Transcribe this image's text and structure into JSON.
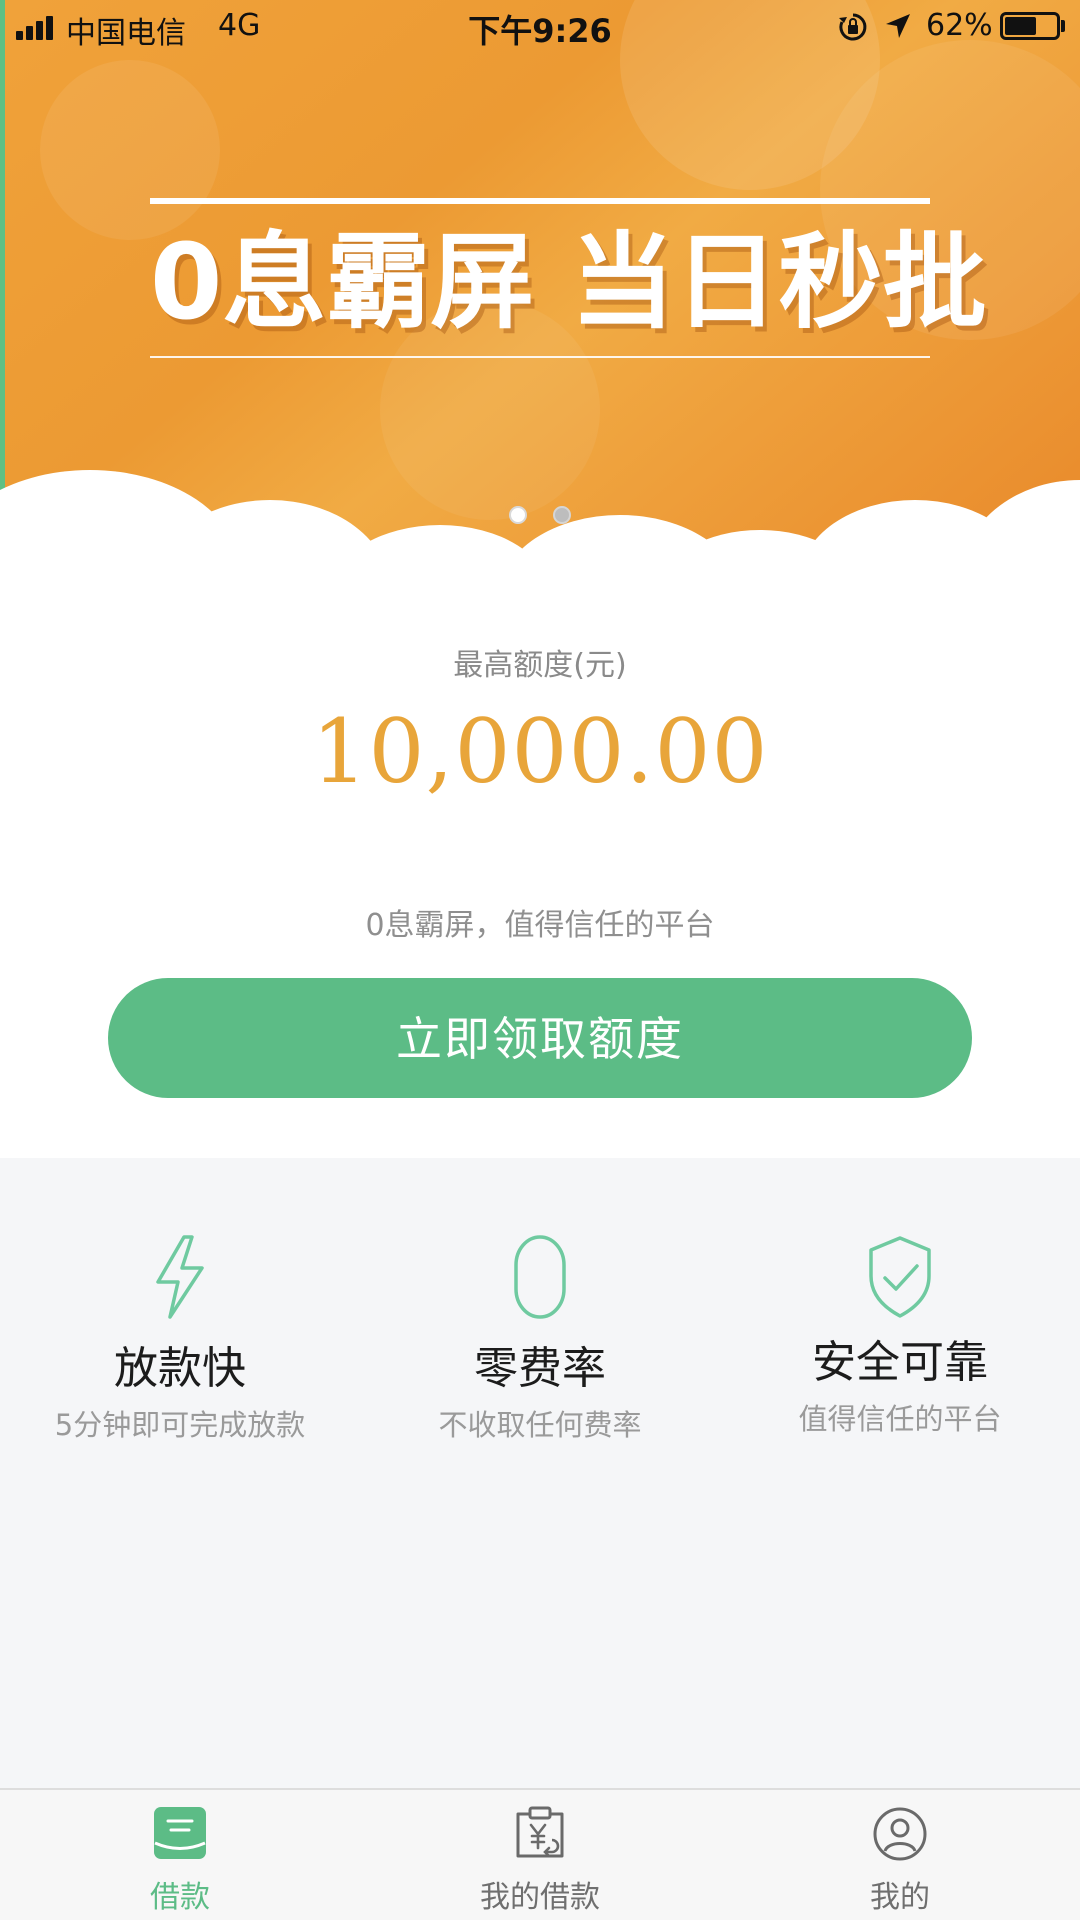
{
  "status_bar": {
    "carrier": "中国电信",
    "network": "4G",
    "time": "下午9:26",
    "battery_percent": "62%",
    "battery_level": 0.62
  },
  "banner": {
    "title": "0息霸屏 当日秒批",
    "slides": 2,
    "active_slide": 0
  },
  "credit": {
    "label": "最高额度(元)",
    "amount": "10,000.00",
    "slogan": "0息霸屏，值得信任的平台",
    "cta_label": "立即领取额度"
  },
  "features": [
    {
      "icon": "lightning-icon",
      "title": "放款快",
      "desc": "5分钟即可完成放款"
    },
    {
      "icon": "zero-icon",
      "title": "零费率",
      "desc": "不收取任何费率"
    },
    {
      "icon": "shield-check-icon",
      "title": "安全可靠",
      "desc": "值得信任的平台"
    }
  ],
  "tabs": [
    {
      "icon": "loan-icon",
      "label": "借款",
      "active": true
    },
    {
      "icon": "my-loans-icon",
      "label": "我的借款",
      "active": false
    },
    {
      "icon": "profile-icon",
      "label": "我的",
      "active": false
    }
  ],
  "colors": {
    "accent": "#5cbc86",
    "amount": "#e8a53a",
    "banner_orange": "#ec9a33"
  }
}
